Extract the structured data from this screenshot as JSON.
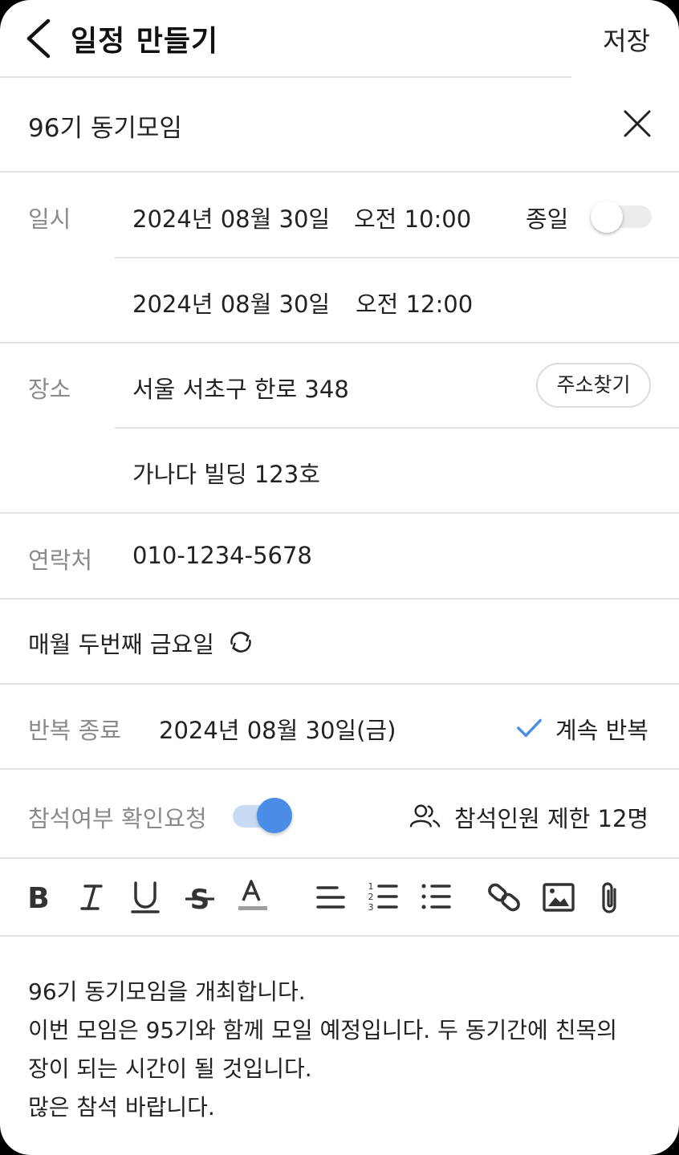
{
  "header": {
    "title": "일정 만들기",
    "save_label": "저장"
  },
  "event_title": "96기 동기모임",
  "datetime": {
    "label": "일시",
    "start_date": "2024년 08월 30일",
    "start_time": "오전 10:00",
    "allday_label": "종일",
    "allday_on": false,
    "end_date": "2024년 08월 30일",
    "end_time": "오전 12:00"
  },
  "location": {
    "label": "장소",
    "address": "서울 서초구 한로 348",
    "find_address_label": "주소찾기",
    "detail": "가나다 빌딩 123호"
  },
  "contact": {
    "label": "연락처",
    "value": "010-1234-5678"
  },
  "repeat": {
    "rule": "매월 두번째 금요일"
  },
  "repeat_end": {
    "label": "반복 종료",
    "date": "2024년 08월 30일(금)",
    "continue_label": "계속 반복",
    "continue_checked": true
  },
  "rsvp": {
    "label": "참석여부 확인요청",
    "on": true,
    "limit_label": "참석인원 제한 12명"
  },
  "toolbar": [
    "bold-icon",
    "italic-icon",
    "underline-icon",
    "strikethrough-icon",
    "text-color-icon",
    "align-icon",
    "numbered-list-icon",
    "bullet-list-icon",
    "link-icon",
    "image-icon",
    "attachment-icon"
  ],
  "colors": {
    "accent": "#4a8de6",
    "divider": "#e3e3e3",
    "label": "#8a8a8a"
  },
  "description": {
    "line1": "96기 동기모임을 개최합니다.",
    "line2": "이번 모임은 95기와 함께 모일 예정입니다. 두 동기간에 친목의",
    "line3": "장이 되는 시간이 될 것입니다.",
    "line4": "많은 참석 바랍니다."
  }
}
